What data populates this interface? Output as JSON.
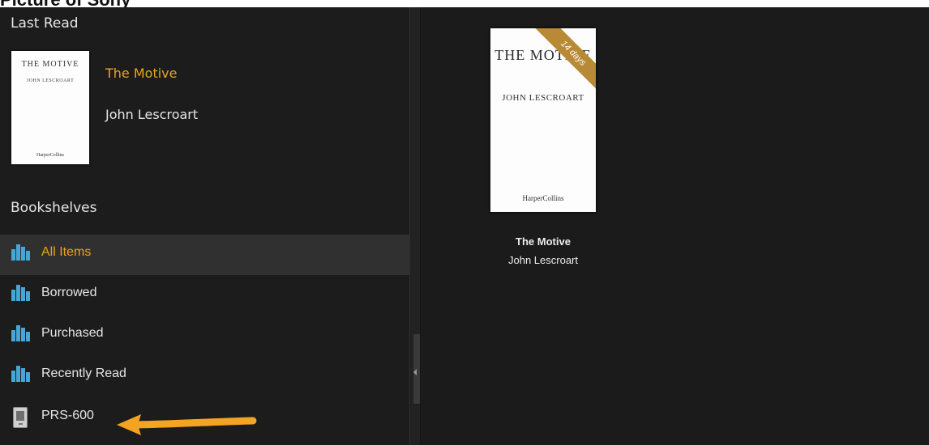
{
  "page_heading": "Picture of Sony",
  "last_read": {
    "section_title": "Last Read",
    "book": {
      "title": "The Motive",
      "author": "John Lescroart",
      "cover_title": "THE MOTIVE",
      "cover_author": "JOHN LESCROART",
      "cover_publisher": "HarperCollins"
    }
  },
  "bookshelves": {
    "section_title": "Bookshelves",
    "items": [
      {
        "label": "All Items",
        "icon": "bookshelf-icon",
        "selected": true
      },
      {
        "label": "Borrowed",
        "icon": "bookshelf-icon",
        "selected": false
      },
      {
        "label": "Purchased",
        "icon": "bookshelf-icon",
        "selected": false
      },
      {
        "label": "Recently Read",
        "icon": "bookshelf-icon",
        "selected": false
      },
      {
        "label": "PRS-600",
        "icon": "ereader-device-icon",
        "selected": false
      }
    ]
  },
  "library": {
    "books": [
      {
        "title": "The Motive",
        "author": "John Lescroart",
        "loan_badge": "14 days",
        "cover_title": "THE MOTIVE",
        "cover_author": "JOHN LESCROART",
        "cover_publisher": "HarperCollins"
      }
    ]
  },
  "colors": {
    "background": "#1b1b1b",
    "accent": "#e8a51e",
    "shelf_icon": "#45a7d6",
    "arrow": "#f3a421",
    "ribbon": "#b98a35"
  }
}
